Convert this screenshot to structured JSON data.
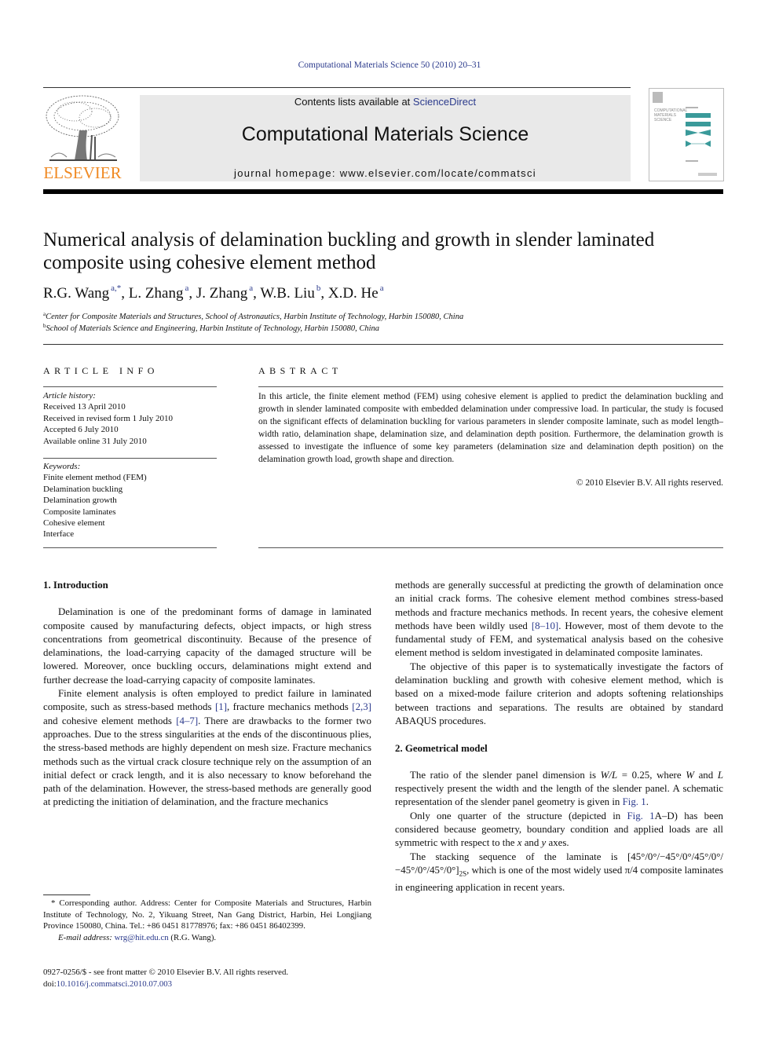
{
  "running_head": "Computational Materials Science 50 (2010) 20–31",
  "masthead": {
    "publisher_wordmark": "ELSEVIER",
    "contents_prefix": "Contents lists available at ",
    "contents_link": "ScienceDirect",
    "journal_title": "Computational Materials Science",
    "homepage_prefix": "journal homepage: ",
    "homepage_url": "www.elsevier.com/locate/commatsci",
    "cover_title_lines": [
      "COMPUTATIONAL",
      "MATERIALS",
      "SCIENCE"
    ],
    "colors": {
      "wordmark": "#f08a24",
      "link": "#2b3a8c",
      "masthead_bg": "#e9e9e9",
      "cover_accent": "#3a9a9a"
    }
  },
  "article": {
    "title": "Numerical analysis of delamination buckling and growth in slender laminated composite using cohesive element method",
    "authors": [
      {
        "name": "R.G. Wang",
        "sup": "a,*"
      },
      {
        "name": "L. Zhang",
        "sup": "a"
      },
      {
        "name": "J. Zhang",
        "sup": "a"
      },
      {
        "name": "W.B. Liu",
        "sup": "b"
      },
      {
        "name": "X.D. He",
        "sup": "a"
      }
    ],
    "affiliations": [
      {
        "mark": "a",
        "text": "Center for Composite Materials and Structures, School of Astronautics, Harbin Institute of Technology, Harbin 150080, China"
      },
      {
        "mark": "b",
        "text": "School of Materials Science and Engineering, Harbin Institute of Technology, Harbin 150080, China"
      }
    ]
  },
  "article_info": {
    "heading": "ARTICLE INFO",
    "history_label": "Article history:",
    "history": [
      "Received 13 April 2010",
      "Received in revised form 1 July 2010",
      "Accepted 6 July 2010",
      "Available online 31 July 2010"
    ],
    "keywords_label": "Keywords:",
    "keywords": [
      "Finite element method (FEM)",
      "Delamination buckling",
      "Delamination growth",
      "Composite laminates",
      "Cohesive element",
      "Interface"
    ]
  },
  "abstract": {
    "heading": "ABSTRACT",
    "text": "In this article, the finite element method (FEM) using cohesive element is applied to predict the delamination buckling and growth in slender laminated composite with embedded delamination under compressive load. In particular, the study is focused on the significant effects of delamination buckling for various parameters in slender composite laminate, such as model length–width ratio, delamination shape, delamination size, and delamination depth position. Furthermore, the delamination growth is assessed to investigate the influence of some key parameters (delamination size and delamination depth position) on the delamination growth load, growth shape and direction.",
    "copyright": "© 2010 Elsevier B.V. All rights reserved."
  },
  "sections": {
    "intro": {
      "heading": "1. Introduction",
      "p1": "Delamination is one of the predominant forms of damage in laminated composite caused by manufacturing defects, object impacts, or high stress concentrations from geometrical discontinuity. Because of the presence of delaminations, the load-carrying capacity of the damaged structure will be lowered. Moreover, once buckling occurs, delaminations might extend and further decrease the load-carrying capacity of composite laminates.",
      "p2_a": "Finite element analysis is often employed to predict failure in laminated composite, such as stress-based methods ",
      "ref1": "[1]",
      "p2_b": ", fracture mechanics methods ",
      "ref2": "[2,3]",
      "p2_c": " and cohesive element methods ",
      "ref3": "[4–7]",
      "p2_d": ". There are drawbacks to the former two approaches. Due to the stress singularities at the ends of the discontinuous plies, the stress-based methods are highly dependent on mesh size. Fracture mechanics methods such as the virtual crack closure technique rely on the assumption of an initial defect or crack length, and it is also necessary to know beforehand the path of the delamination. However, the stress-based methods are generally good at predicting the initiation of delamination, and the fracture mechanics",
      "p3_a": "methods are generally successful at predicting the growth of delamination once an initial crack forms. The cohesive element method combines stress-based methods and fracture mechanics methods. In recent years, the cohesive element methods have been wildly used ",
      "ref4": "[8–10]",
      "p3_b": ". However, most of them devote to the fundamental study of FEM, and systematical analysis based on the cohesive element method is seldom investigated in delaminated composite laminates.",
      "p4": "The objective of this paper is to systematically investigate the factors of delamination buckling and growth with cohesive element method, which is based on a mixed-mode failure criterion and adopts softening relationships between tractions and separations. The results are obtained by standard ABAQUS procedures."
    },
    "geom": {
      "heading": "2. Geometrical model",
      "p1_a": "The ratio of the slender panel dimension is ",
      "ratio_expr": "W/L",
      "p1_b": " = 0.25, where ",
      "var_w": "W",
      "p1_c": " and ",
      "var_l": "L",
      "p1_d": " respectively present the width and the length of the slender panel. A schematic representation of the slender panel geometry is given in ",
      "fig_ref": "Fig. 1",
      "p1_e": ".",
      "p2_a": "Only one quarter of the structure (depicted in ",
      "fig_ref2": "Fig. 1",
      "p2_b": "A–D) has been considered because geometry, boundary condition and applied loads are all symmetric with respect to the ",
      "var_x": "x",
      "p2_c": " and ",
      "var_y": "y",
      "p2_d": " axes.",
      "p3_a": "The stacking sequence of the laminate is [45°/0°/−45°/0°/45°/0°/−45°/0°/45°/0°]",
      "p3_sub": "2S",
      "p3_b": ", which is one of the most widely used π/4 composite laminates in engineering application in recent years."
    }
  },
  "footnote": {
    "star": "*",
    "text": "Corresponding author. Address: Center for Composite Materials and Structures, Harbin Institute of Technology, No. 2, Yikuang Street, Nan Gang District, Harbin, Hei Longjiang Province 150080, China. Tel.: +86 0451 81778976; fax: +86 0451 86402399.",
    "email_label": "E-mail address:",
    "email": "wrg@hit.edu.cn",
    "email_owner": " (R.G. Wang)."
  },
  "front_matter": {
    "issn_line": "0927-0256/$ - see front matter © 2010 Elsevier B.V. All rights reserved.",
    "doi_label": "doi:",
    "doi": "10.1016/j.commatsci.2010.07.003"
  }
}
